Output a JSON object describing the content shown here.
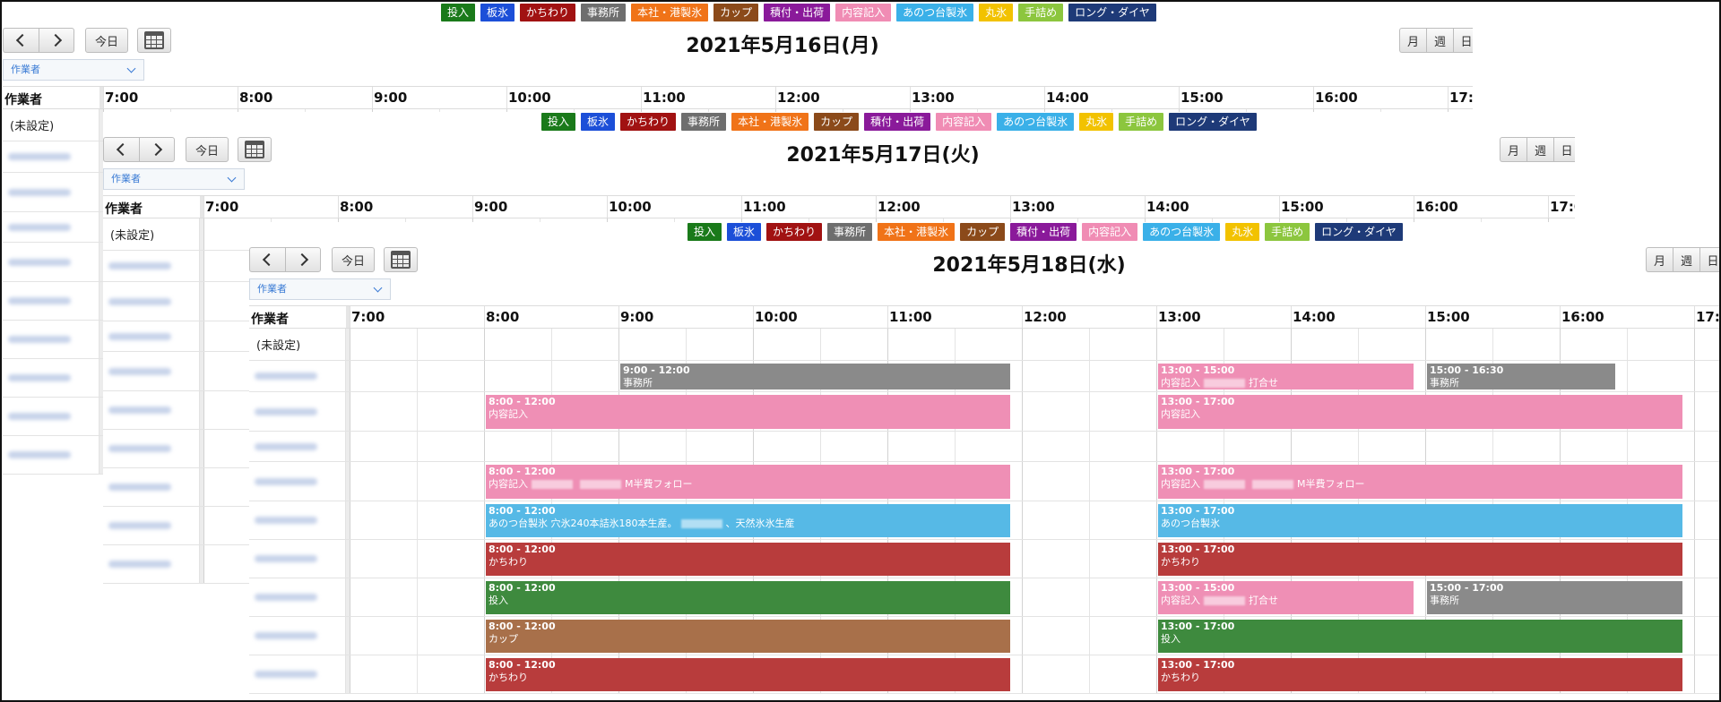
{
  "legend": [
    {
      "label": "投入",
      "color": "#1a7a1a"
    },
    {
      "label": "板氷",
      "color": "#1c4fd8"
    },
    {
      "label": "かちわり",
      "color": "#a11212"
    },
    {
      "label": "事務所",
      "color": "#6e6e6e"
    },
    {
      "label": "本社・港製氷",
      "color": "#f07318"
    },
    {
      "label": "カップ",
      "color": "#8b4a1a"
    },
    {
      "label": "積付・出荷",
      "color": "#8a1a9a"
    },
    {
      "label": "内容記入",
      "color": "#f08cb4"
    },
    {
      "label": "あのつ台製氷",
      "color": "#3ab0e8"
    },
    {
      "label": "丸氷",
      "color": "#f2c200"
    },
    {
      "label": "手詰め",
      "color": "#8cc63e"
    },
    {
      "label": "ロング・ダイヤ",
      "color": "#1e3a78"
    }
  ],
  "toolbar": {
    "today_label": "今日",
    "views": [
      "月",
      "週",
      "日"
    ],
    "resource_select": "作業者"
  },
  "grid": {
    "resource_header": "作業者",
    "unset_label": "(未設定)",
    "hours": [
      "7:00",
      "8:00",
      "9:00",
      "10:00",
      "11:00",
      "12:00",
      "13:00",
      "14:00",
      "15:00",
      "16:00",
      "17:00"
    ]
  },
  "panels": [
    {
      "title": "2021年5月16日(月)",
      "rows": 10,
      "events": []
    },
    {
      "title": "2021年5月17日(火)",
      "rows": 10,
      "events": []
    },
    {
      "title": "2021年5月18日(水)",
      "rows": 10,
      "events": [
        {
          "row": 1,
          "start": 9,
          "end": 12,
          "time": "9:00 - 12:00",
          "desc": "事務所",
          "color": "#8a8a8a"
        },
        {
          "row": 1,
          "start": 13,
          "end": 15,
          "time": "13:00 - 15:00",
          "desc": "内容記入",
          "redact": true,
          "desc2": "打合せ",
          "color": "#ef8fb5"
        },
        {
          "row": 1,
          "start": 15,
          "end": 16.5,
          "time": "15:00 - 16:30",
          "desc": "事務所",
          "color": "#8a8a8a"
        },
        {
          "row": 2,
          "start": 8,
          "end": 12,
          "time": "8:00 - 12:00",
          "desc": "内容記入",
          "color": "#ef8fb5"
        },
        {
          "row": 2,
          "start": 13,
          "end": 17,
          "time": "13:00 - 17:00",
          "desc": "内容記入",
          "color": "#ef8fb5"
        },
        {
          "row": 4,
          "start": 8,
          "end": 12,
          "time": "8:00 - 12:00",
          "desc": "内容記入",
          "redact": true,
          "redact2": true,
          "desc2": "M半費フォロー",
          "color": "#ef8fb5"
        },
        {
          "row": 4,
          "start": 13,
          "end": 17,
          "time": "13:00 - 17:00",
          "desc": "内容記入",
          "redact": true,
          "redact2": true,
          "desc2": "M半費フォロー",
          "color": "#ef8fb5"
        },
        {
          "row": 5,
          "start": 8,
          "end": 12,
          "time": "8:00 - 12:00",
          "desc": "あのつ台製氷 穴氷240本詰氷180本生産。",
          "redact": true,
          "desc2": "、天然氷氷生産",
          "color": "#56b9e6"
        },
        {
          "row": 5,
          "start": 13,
          "end": 17,
          "time": "13:00 - 17:00",
          "desc": "あのつ台製氷",
          "color": "#56b9e6"
        },
        {
          "row": 6,
          "start": 8,
          "end": 12,
          "time": "8:00 - 12:00",
          "desc": "かちわり",
          "color": "#b83c3c"
        },
        {
          "row": 6,
          "start": 13,
          "end": 17,
          "time": "13:00 - 17:00",
          "desc": "かちわり",
          "color": "#b83c3c"
        },
        {
          "row": 7,
          "start": 8,
          "end": 12,
          "time": "8:00 - 12:00",
          "desc": "投入",
          "color": "#3e8a3e"
        },
        {
          "row": 7,
          "start": 13,
          "end": 15,
          "time": "13:00 - 15:00",
          "desc": "内容記入",
          "redact": true,
          "desc2": "打合せ",
          "color": "#ef8fb5"
        },
        {
          "row": 7,
          "start": 15,
          "end": 17,
          "time": "15:00 - 17:00",
          "desc": "事務所",
          "color": "#8a8a8a"
        },
        {
          "row": 8,
          "start": 8,
          "end": 12,
          "time": "8:00 - 12:00",
          "desc": "カップ",
          "color": "#a8704a"
        },
        {
          "row": 8,
          "start": 13,
          "end": 17,
          "time": "13:00 - 17:00",
          "desc": "投入",
          "color": "#3e8a3e"
        },
        {
          "row": 9,
          "start": 8,
          "end": 12,
          "time": "8:00 - 12:00",
          "desc": "かちわり",
          "color": "#b83c3c"
        },
        {
          "row": 9,
          "start": 13,
          "end": 17,
          "time": "13:00 - 17:00",
          "desc": "かちわり",
          "color": "#b83c3c"
        }
      ]
    }
  ]
}
